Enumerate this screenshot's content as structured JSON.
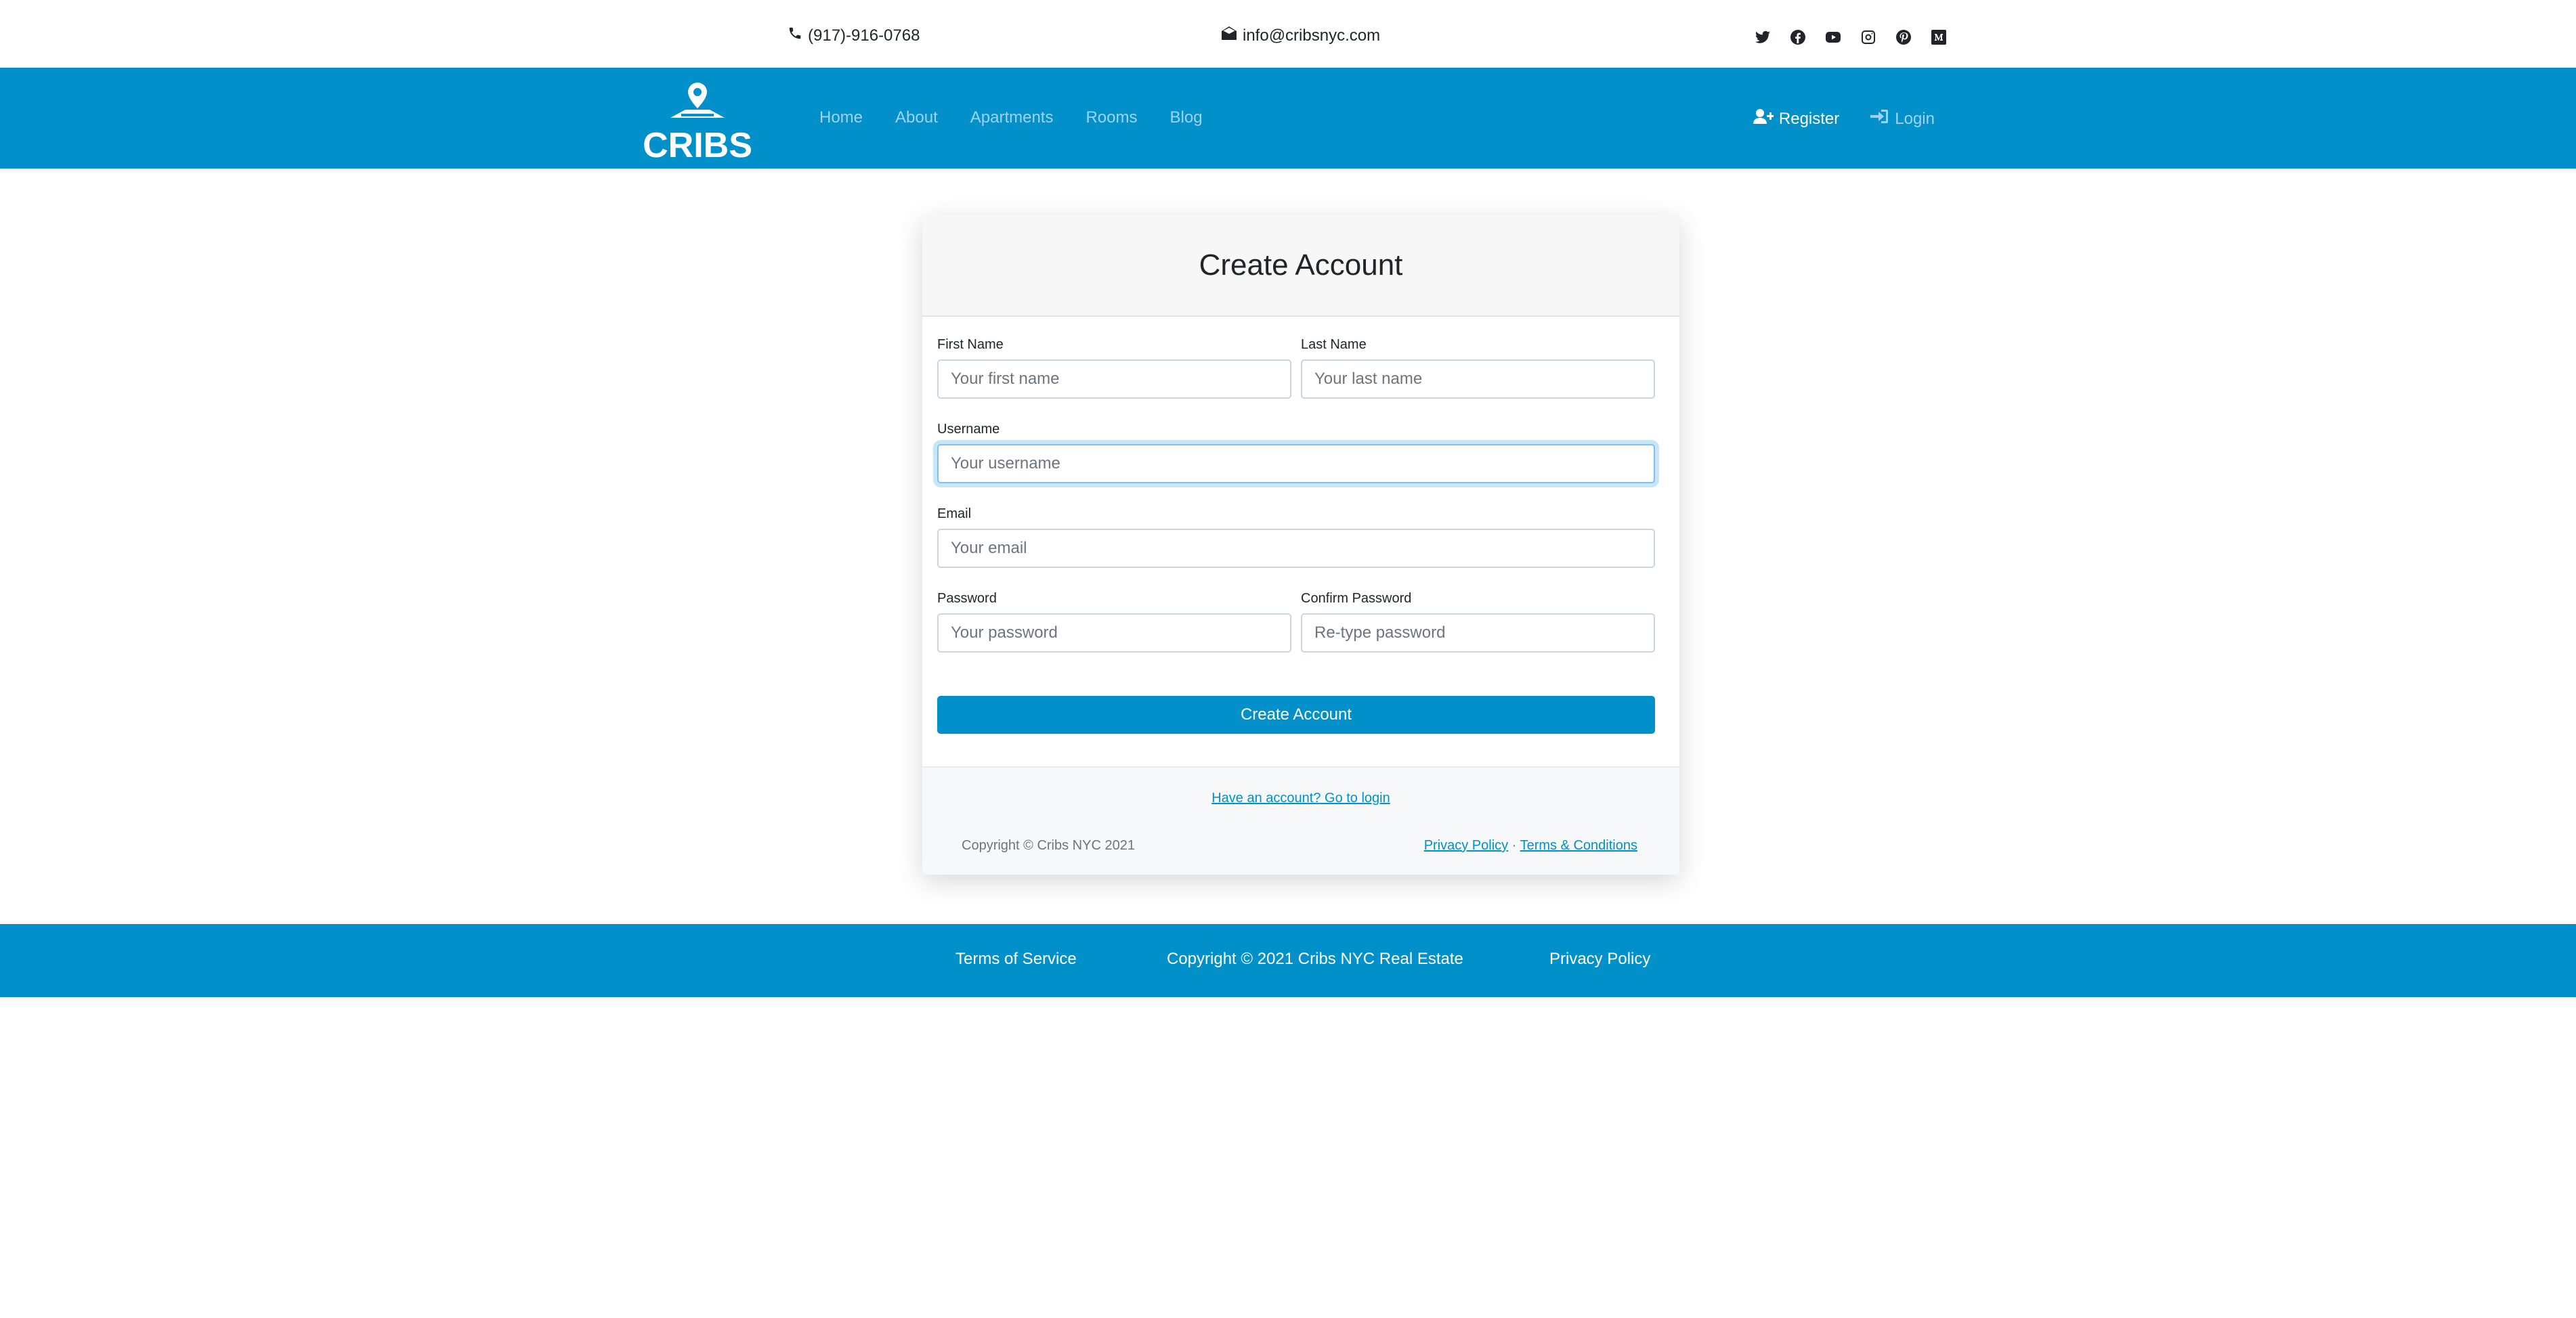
{
  "topbar": {
    "phone": "(917)-916-0768",
    "email": "info@cribsnyc.com",
    "social_icons": [
      "twitter-icon",
      "facebook-icon",
      "youtube-icon",
      "instagram-icon",
      "pinterest-icon",
      "medium-icon"
    ]
  },
  "navbar": {
    "logo_text": "CRIBS",
    "links": [
      "Home",
      "About",
      "Apartments",
      "Rooms",
      "Blog"
    ],
    "register": "Register",
    "login": "Login"
  },
  "form": {
    "title": "Create Account",
    "first_name": {
      "label": "First Name",
      "placeholder": "Your first name"
    },
    "last_name": {
      "label": "Last Name",
      "placeholder": "Your last name"
    },
    "username": {
      "label": "Username",
      "placeholder": "Your username"
    },
    "email": {
      "label": "Email",
      "placeholder": "Your email"
    },
    "password": {
      "label": "Password",
      "placeholder": "Your password"
    },
    "confirm_password": {
      "label": "Confirm Password",
      "placeholder": "Re-type password"
    },
    "submit": "Create Account",
    "have_account": "Have an account? Go to login",
    "copyright": "Copyright © Cribs NYC 2021",
    "privacy": "Privacy Policy",
    "separator": " · ",
    "terms": "Terms & Conditions"
  },
  "footer": {
    "terms_of_service": "Terms of Service",
    "copyright": "Copyright © 2021 Cribs NYC Real Estate",
    "privacy_policy": "Privacy Policy"
  },
  "colors": {
    "brand": "#0290cb",
    "nav_link": "#9fd3ef"
  }
}
